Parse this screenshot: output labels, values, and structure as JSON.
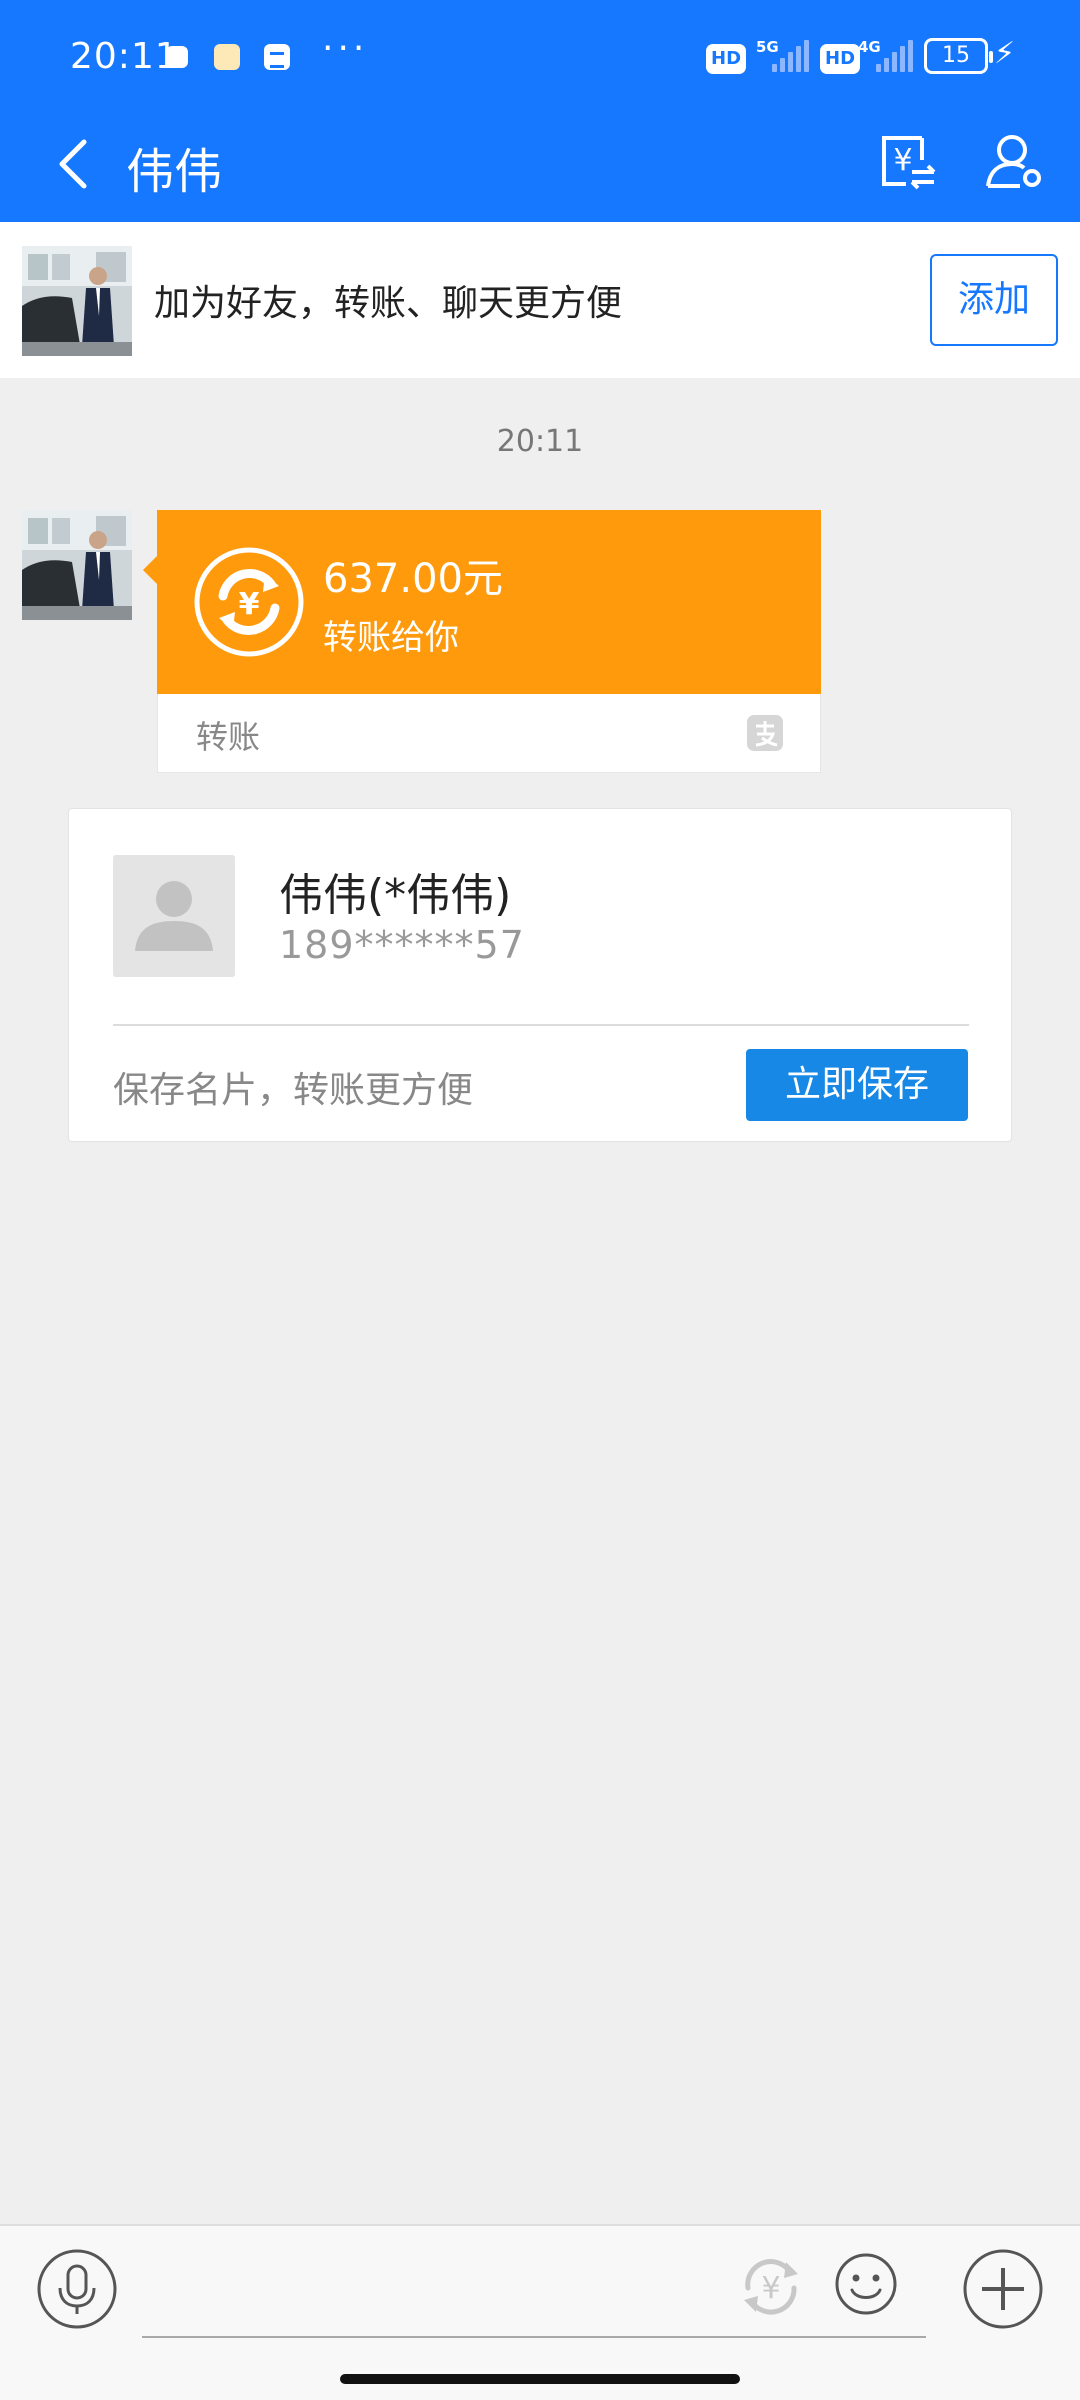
{
  "status_bar": {
    "time": "20:11",
    "more": "···",
    "hd1": "HD",
    "net1": "5G",
    "hd2": "HD",
    "net2": "4G",
    "battery": "15"
  },
  "header": {
    "title": "伟伟",
    "accent_color": "#1677ff"
  },
  "banner": {
    "text": "加为好友，转账、聊天更方便",
    "add_label": "添加"
  },
  "chat": {
    "timestamp": "20:11",
    "transfer": {
      "amount": "637.00元",
      "description": "转账给你",
      "label": "转账",
      "color": "#ff9a0c"
    },
    "contact_card": {
      "name": "伟伟(*伟伟)",
      "phone": "189******57",
      "hint": "保存名片，转账更方便",
      "save_label": "立即保存"
    }
  },
  "input": {
    "placeholder": ""
  },
  "icons": [
    "back-icon",
    "transfer-icon",
    "profile-icon",
    "yuan-coin-icon",
    "alipay-icon",
    "microphone-icon",
    "emoji-icon",
    "plus-icon"
  ]
}
